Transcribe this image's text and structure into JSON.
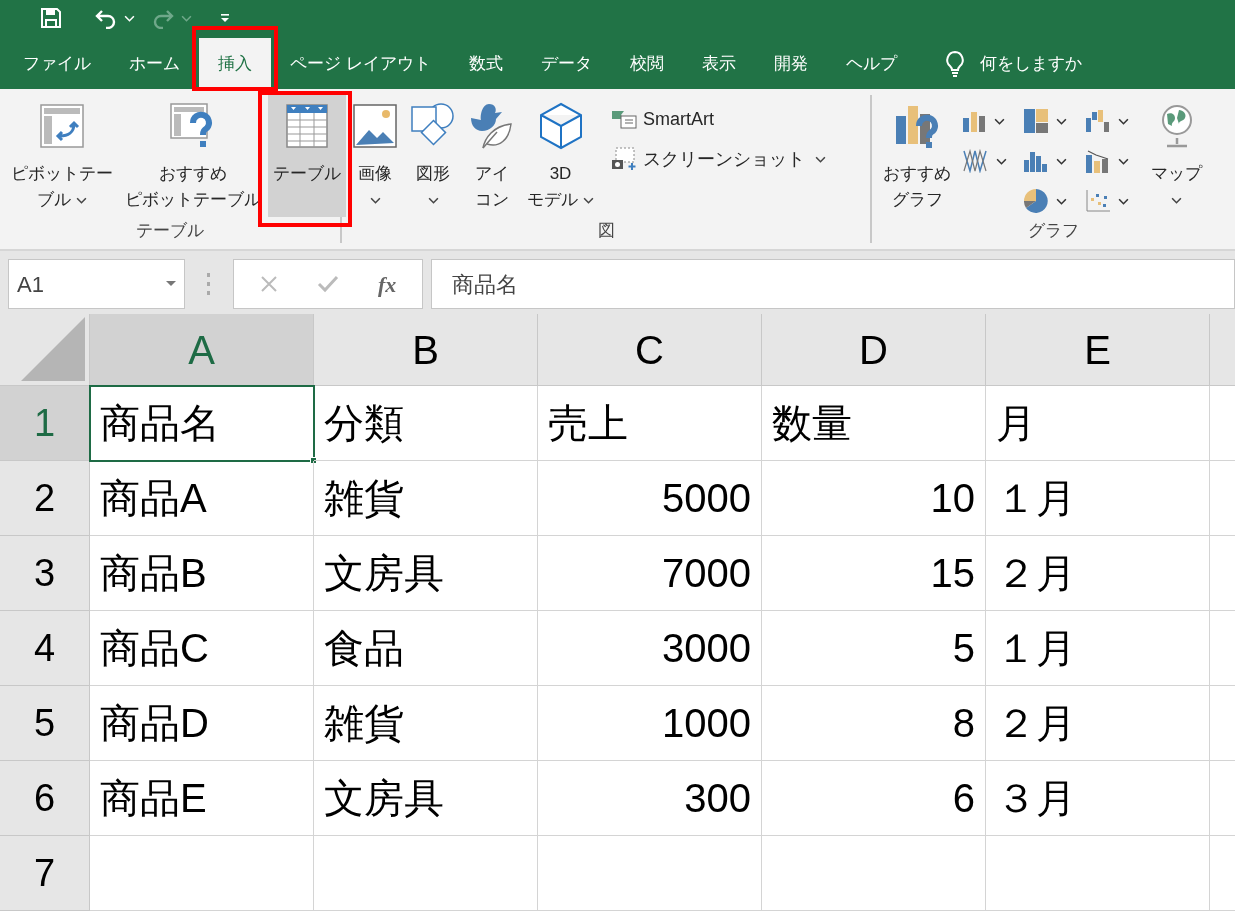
{
  "quick_access": [
    {
      "kind": "save",
      "disabled": false
    },
    {
      "kind": "undo",
      "disabled": false
    },
    {
      "kind": "redo",
      "disabled": true
    },
    {
      "kind": "customize",
      "disabled": false
    }
  ],
  "tabs": [
    {
      "label": "ファイル",
      "selected": false,
      "highlighted": false
    },
    {
      "label": "ホーム",
      "selected": false,
      "highlighted": false
    },
    {
      "label": "挿入",
      "selected": true,
      "highlighted": true
    },
    {
      "label": "ページ レイアウト",
      "selected": false,
      "highlighted": false
    },
    {
      "label": "数式",
      "selected": false,
      "highlighted": false
    },
    {
      "label": "データ",
      "selected": false,
      "highlighted": false
    },
    {
      "label": "校閲",
      "selected": false,
      "highlighted": false
    },
    {
      "label": "表示",
      "selected": false,
      "highlighted": false
    },
    {
      "label": "開発",
      "selected": false,
      "highlighted": false
    },
    {
      "label": "ヘルプ",
      "selected": false,
      "highlighted": false
    }
  ],
  "tell_me": {
    "placeholder": "何をしますか"
  },
  "ribbon_groups": [
    {
      "label": "テーブル",
      "items": [
        {
          "kind": "large",
          "lines": [
            "ピボットテー",
            "ブル"
          ],
          "dropdown": true,
          "pressed": false,
          "highlighted": false
        },
        {
          "kind": "large",
          "lines": [
            "おすすめ",
            "ピボットテーブル"
          ],
          "dropdown": false,
          "pressed": false,
          "highlighted": false
        },
        {
          "kind": "large",
          "lines": [
            "テーブル"
          ],
          "dropdown": false,
          "pressed": true,
          "highlighted": true
        }
      ]
    },
    {
      "label": "図",
      "items": [
        {
          "kind": "large",
          "lines": [
            "画像"
          ],
          "dropdown": true,
          "pressed": false,
          "highlighted": false
        },
        {
          "kind": "large",
          "lines": [
            "図形"
          ],
          "dropdown": true,
          "pressed": false,
          "highlighted": false
        },
        {
          "kind": "large",
          "lines": [
            "アイ",
            "コン"
          ],
          "dropdown": false,
          "pressed": false,
          "highlighted": false
        },
        {
          "kind": "large",
          "lines": [
            "3D",
            "モデル"
          ],
          "dropdown": true,
          "pressed": false,
          "highlighted": false
        },
        {
          "kind": "small",
          "lines": [
            "SmartArt"
          ],
          "dropdown": false,
          "pressed": false,
          "highlighted": false
        },
        {
          "kind": "small",
          "lines": [
            "スクリーンショット"
          ],
          "dropdown": true,
          "pressed": false,
          "highlighted": false
        }
      ]
    },
    {
      "label": "グラフ",
      "items": [
        {
          "kind": "large",
          "lines": [
            "おすすめ",
            "グラフ"
          ],
          "dropdown": false,
          "pressed": false,
          "highlighted": false
        },
        {
          "kind": "gallery"
        },
        {
          "kind": "large",
          "lines": [
            "マップ"
          ],
          "dropdown": true,
          "pressed": false,
          "highlighted": false
        }
      ]
    }
  ],
  "name_box": "A1",
  "function_label": "fx",
  "formula": "商品名",
  "sheet": {
    "columns": [
      {
        "label": "A",
        "selected": true
      },
      {
        "label": "B",
        "selected": false
      },
      {
        "label": "C",
        "selected": false
      },
      {
        "label": "D",
        "selected": false
      },
      {
        "label": "E",
        "selected": false
      }
    ],
    "rows": [
      {
        "header": "1",
        "selected": true,
        "cells": [
          {
            "text": "商品名",
            "active": true
          },
          {
            "text": "分類",
            "active": false
          },
          {
            "text": "売上",
            "active": false
          },
          {
            "text": "数量",
            "active": false
          },
          {
            "text": "月",
            "active": false
          }
        ]
      },
      {
        "header": "2",
        "selected": false,
        "cells": [
          {
            "text": "商品A",
            "active": false
          },
          {
            "text": "雑貨",
            "active": false
          },
          {
            "text": "5000",
            "active": false
          },
          {
            "text": "10",
            "active": false
          },
          {
            "text": "１月",
            "active": false
          }
        ]
      },
      {
        "header": "3",
        "selected": false,
        "cells": [
          {
            "text": "商品B",
            "active": false
          },
          {
            "text": "文房具",
            "active": false
          },
          {
            "text": "7000",
            "active": false
          },
          {
            "text": "15",
            "active": false
          },
          {
            "text": "２月",
            "active": false
          }
        ]
      },
      {
        "header": "4",
        "selected": false,
        "cells": [
          {
            "text": "商品C",
            "active": false
          },
          {
            "text": "食品",
            "active": false
          },
          {
            "text": "3000",
            "active": false
          },
          {
            "text": "5",
            "active": false
          },
          {
            "text": "１月",
            "active": false
          }
        ]
      },
      {
        "header": "5",
        "selected": false,
        "cells": [
          {
            "text": "商品D",
            "active": false
          },
          {
            "text": "雑貨",
            "active": false
          },
          {
            "text": "1000",
            "active": false
          },
          {
            "text": "8",
            "active": false
          },
          {
            "text": "２月",
            "active": false
          }
        ]
      },
      {
        "header": "6",
        "selected": false,
        "cells": [
          {
            "text": "商品E",
            "active": false
          },
          {
            "text": "文房具",
            "active": false
          },
          {
            "text": "300",
            "active": false
          },
          {
            "text": "6",
            "active": false
          },
          {
            "text": "３月",
            "active": false
          }
        ]
      },
      {
        "header": "7",
        "selected": false
      }
    ]
  }
}
